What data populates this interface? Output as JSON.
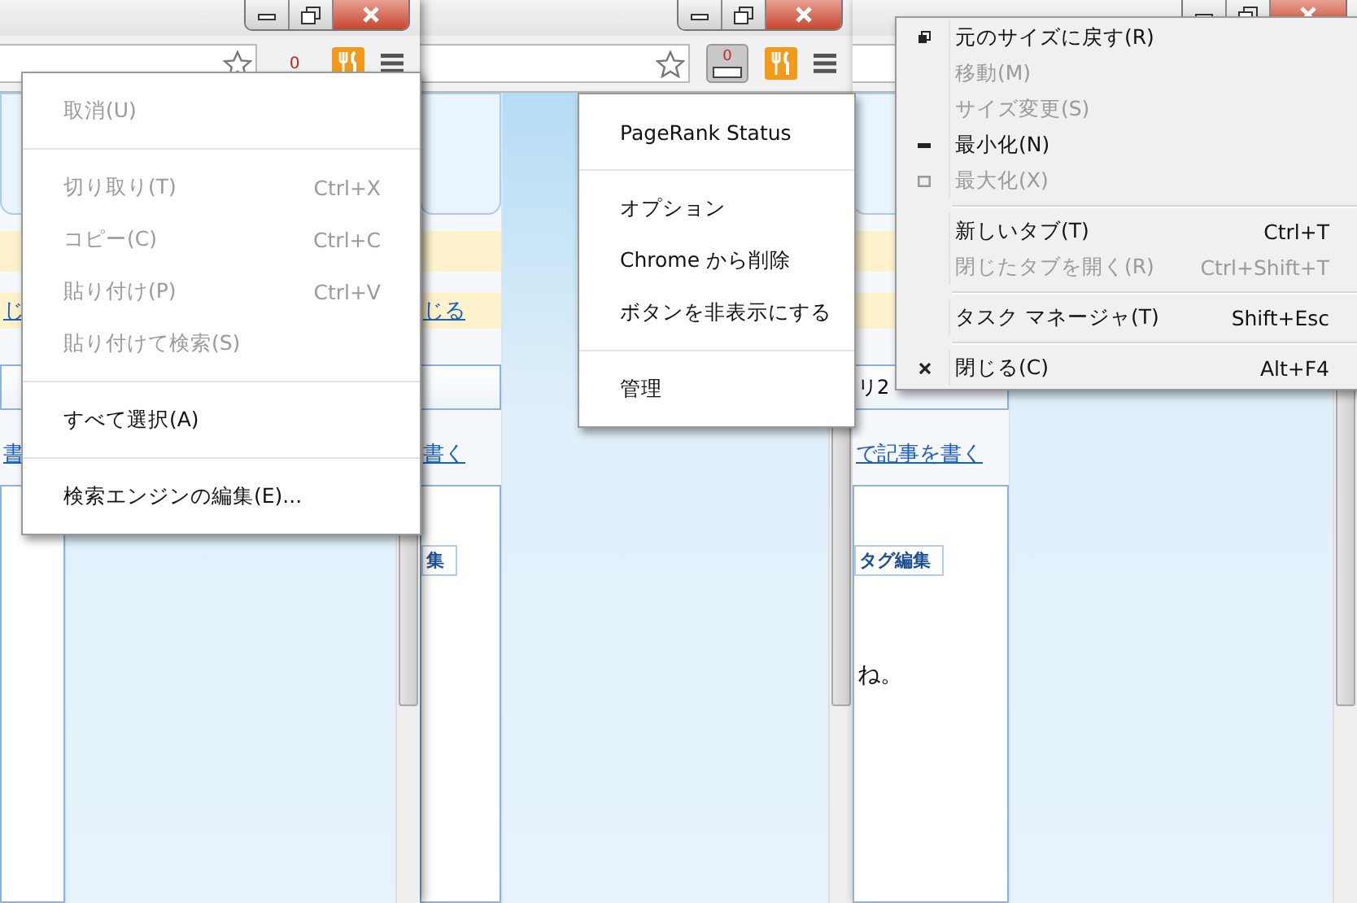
{
  "windows": [
    {
      "toolbar": {
        "badge": {
          "kind": "counter",
          "text": "0",
          "pressed": false
        }
      },
      "strip": [
        {
          "kind": "panel"
        },
        {
          "kind": "notice"
        },
        {
          "kind": "notice",
          "link": "じ"
        },
        {
          "kind": "select"
        },
        {
          "kind": "link",
          "text": "書"
        },
        {
          "kind": "box"
        }
      ]
    },
    {
      "toolbar": {
        "badge": {
          "kind": "meter",
          "text": "0",
          "pressed": true
        }
      },
      "strip": [
        {
          "kind": "panel"
        },
        {
          "kind": "notice"
        },
        {
          "kind": "notice",
          "link": "じる"
        },
        {
          "kind": "select"
        },
        {
          "kind": "link",
          "text": "書く"
        },
        {
          "kind": "box",
          "button": "集"
        }
      ]
    },
    {
      "strip": [
        {
          "kind": "panel"
        },
        {
          "kind": "notice"
        },
        {
          "kind": "notice"
        },
        {
          "kind": "select",
          "text": "リ2"
        },
        {
          "kind": "link",
          "text": "で記事を書く"
        },
        {
          "kind": "box",
          "button": "タグ編集",
          "text": "ね。"
        }
      ]
    }
  ],
  "menus": [
    {
      "items": [
        {
          "kind": "item",
          "label": "取消(U)",
          "disabled": true
        },
        {
          "kind": "separator"
        },
        {
          "kind": "item",
          "label": "切り取り(T)",
          "shortcut": "Ctrl+X",
          "disabled": true
        },
        {
          "kind": "item",
          "label": "コピー(C)",
          "shortcut": "Ctrl+C",
          "disabled": true
        },
        {
          "kind": "item",
          "label": "貼り付け(P)",
          "shortcut": "Ctrl+V",
          "disabled": true
        },
        {
          "kind": "item",
          "label": "貼り付けて検索(S)",
          "disabled": true
        },
        {
          "kind": "separator"
        },
        {
          "kind": "item",
          "label": "すべて選択(A)",
          "disabled": false
        },
        {
          "kind": "separator"
        },
        {
          "kind": "item",
          "label": "検索エンジンの編集(E)...",
          "disabled": false
        }
      ]
    },
    {
      "items": [
        {
          "kind": "item",
          "label": "PageRank Status",
          "disabled": false
        },
        {
          "kind": "separator"
        },
        {
          "kind": "item",
          "label": "オプション",
          "disabled": false
        },
        {
          "kind": "item",
          "label": "Chrome から削除",
          "disabled": false
        },
        {
          "kind": "item",
          "label": "ボタンを非表示にする",
          "disabled": false
        },
        {
          "kind": "separator"
        },
        {
          "kind": "item",
          "label": "管理",
          "disabled": false
        }
      ]
    },
    {
      "items": [
        {
          "kind": "item",
          "label": "元のサイズに戻す(R)",
          "disabled": false
        },
        {
          "kind": "item",
          "label": "移動(M)",
          "disabled": true
        },
        {
          "kind": "item",
          "label": "サイズ変更(S)",
          "disabled": true
        },
        {
          "kind": "item",
          "label": "最小化(N)",
          "disabled": false
        },
        {
          "kind": "item",
          "label": "最大化(X)",
          "disabled": true
        },
        {
          "kind": "separator"
        },
        {
          "kind": "item",
          "label": "新しいタブ(T)",
          "shortcut": "Ctrl+T",
          "disabled": false
        },
        {
          "kind": "item",
          "label": "閉じたタブを開く(R)",
          "shortcut": "Ctrl+Shift+T",
          "disabled": true
        },
        {
          "kind": "separator"
        },
        {
          "kind": "item",
          "label": "タスク マネージャ(T)",
          "shortcut": "Shift+Esc",
          "disabled": false
        },
        {
          "kind": "separator"
        },
        {
          "kind": "item",
          "label": "閉じる(C)",
          "shortcut": "Alt+F4",
          "disabled": false
        }
      ]
    }
  ]
}
